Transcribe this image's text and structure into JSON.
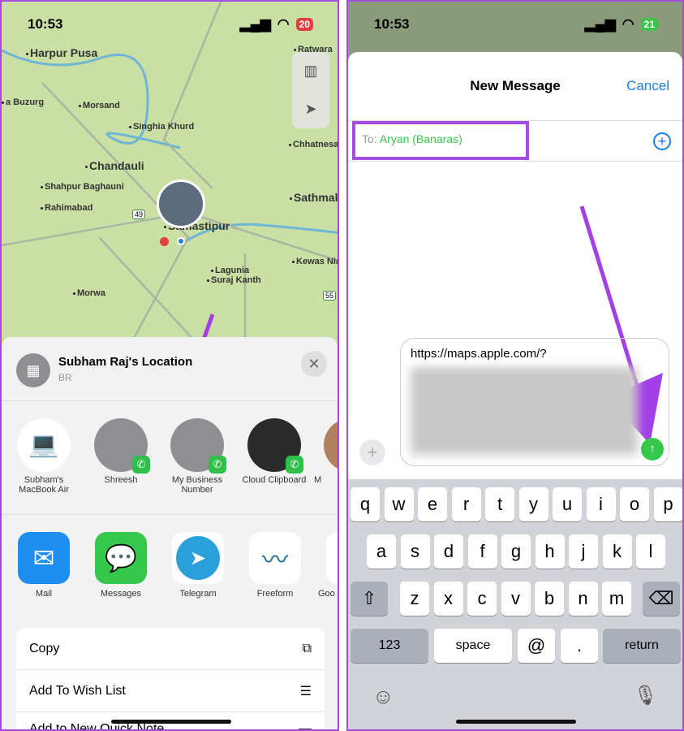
{
  "left": {
    "status": {
      "time": "10:53",
      "battery": "20"
    },
    "map": {
      "places": [
        "Harpur Pusa",
        "Ratwara",
        "a Buzurg",
        "Morsand",
        "Singhia Khurd",
        "Chhatnesa",
        "Chandauli",
        "Shahpur Baghauni",
        "Sathmalp",
        "Rahimabad",
        "Samastipur",
        "Kewas Nia",
        "Lagunia",
        "Suraj Kanth",
        "Morwa"
      ],
      "highways": [
        "49",
        "55"
      ]
    },
    "sheet": {
      "title": "Subham Raj's Location",
      "subtitle": "BR",
      "people": [
        {
          "name": "Subham's MacBook Air"
        },
        {
          "name": "Shreesh"
        },
        {
          "name": "My Business Number"
        },
        {
          "name": "Cloud Clipboard"
        },
        {
          "name": "M"
        }
      ],
      "apps": [
        {
          "name": "Mail",
          "color": "#1e8ef0"
        },
        {
          "name": "Messages",
          "color": "#35c84b"
        },
        {
          "name": "Telegram",
          "color": "#2aa0da"
        },
        {
          "name": "Freeform",
          "color": "#ffffff"
        },
        {
          "name": "Goo"
        }
      ],
      "actions": [
        {
          "label": "Copy",
          "icon": "copy-icon"
        },
        {
          "label": "Add To Wish List",
          "icon": "checklist-icon"
        },
        {
          "label": "Add to New Quick Note",
          "icon": "note-icon"
        }
      ]
    }
  },
  "right": {
    "status": {
      "time": "10:53",
      "battery": "21"
    },
    "header": {
      "title": "New Message",
      "cancel": "Cancel"
    },
    "to": {
      "label": "To:",
      "recipient": "Aryan (Banaras)"
    },
    "message": {
      "text": "https://maps.apple.com/?"
    },
    "keyboard": {
      "row1": [
        "q",
        "w",
        "e",
        "r",
        "t",
        "y",
        "u",
        "i",
        "o",
        "p"
      ],
      "row2": [
        "a",
        "s",
        "d",
        "f",
        "g",
        "h",
        "j",
        "k",
        "l"
      ],
      "row3": [
        "z",
        "x",
        "c",
        "v",
        "b",
        "n",
        "m"
      ],
      "numbers": "123",
      "space": "space",
      "at": "@",
      "period": ".",
      "return": "return"
    }
  },
  "accent": "#a64be0"
}
